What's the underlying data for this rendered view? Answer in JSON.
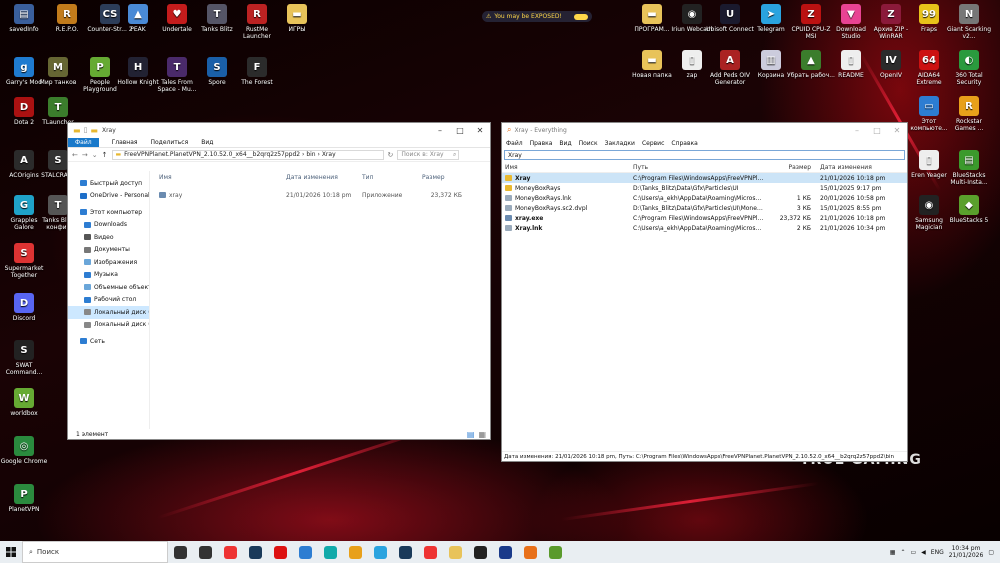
{
  "notification": {
    "text": "You may be EXPOSED!"
  },
  "desktop_icons": [
    {
      "label": "savedInfo",
      "color": "#3a5f9c",
      "glyph": "▤"
    },
    {
      "label": "R.E.P.O.",
      "color": "#c27b1b",
      "glyph": "R"
    },
    {
      "label": "Counter-Str... 2",
      "color": "#2c3d59",
      "glyph": "CS"
    },
    {
      "label": "PEAK",
      "color": "#4a8ad6",
      "glyph": "▲"
    },
    {
      "label": "Undertale",
      "color": "#c41c1c",
      "glyph": "♥"
    },
    {
      "label": "Tanks Blitz",
      "color": "#556",
      "glyph": "T"
    },
    {
      "label": "RustMe Launcher",
      "color": "#b22",
      "glyph": "R"
    },
    {
      "label": "ИГРЫ",
      "color": "#e8c35a",
      "glyph": "▬"
    },
    {
      "label": "Garry's Mod",
      "color": "#1f7bd0",
      "glyph": "g"
    },
    {
      "label": "Мир танков",
      "color": "#663",
      "glyph": "M"
    },
    {
      "label": "People Playground",
      "color": "#6a3",
      "glyph": "P"
    },
    {
      "label": "Hollow Knight",
      "color": "#223",
      "glyph": "H"
    },
    {
      "label": "Tales From Space - Mu...",
      "color": "#4a2a6a",
      "glyph": "T"
    },
    {
      "label": "Spore",
      "color": "#1a5fa8",
      "glyph": "S"
    },
    {
      "label": "The Forest",
      "color": "#2b2b2b",
      "glyph": "F"
    },
    {
      "label": "Dota 2",
      "color": "#a11",
      "glyph": "D"
    },
    {
      "label": "TLauncher",
      "color": "#3b7d2c",
      "glyph": "T"
    },
    {
      "label": "ACOrigins",
      "color": "#2b2b2b",
      "glyph": "A"
    },
    {
      "label": "STALCRAFT",
      "color": "#333",
      "glyph": "S"
    },
    {
      "label": "Grapples Galore",
      "color": "#1fa2c8",
      "glyph": "G"
    },
    {
      "label": "Tanks Blitz конфиг",
      "color": "#555",
      "glyph": "T"
    },
    {
      "label": "Supermarket Together",
      "color": "#d33",
      "glyph": "S"
    },
    {
      "label": "Discord",
      "color": "#5865f2",
      "glyph": "D"
    },
    {
      "label": "SWAT Command...",
      "color": "#222",
      "glyph": "S"
    },
    {
      "label": "worldbox",
      "color": "#6a3",
      "glyph": "W"
    },
    {
      "label": "Google Chrome",
      "color": "#2a8a3e",
      "glyph": "◎"
    },
    {
      "label": "PlanetVPN",
      "color": "#2b8a3e",
      "glyph": "P"
    },
    {
      "label": "ПРОГРАМ...",
      "color": "#e8c35a",
      "glyph": "▬"
    },
    {
      "label": "Iriun Webcam",
      "color": "#222",
      "glyph": "◉"
    },
    {
      "label": "Ubisoft Connect",
      "color": "#1a1a2e",
      "glyph": "U"
    },
    {
      "label": "Telegram",
      "color": "#2aa3df",
      "glyph": "➤"
    },
    {
      "label": "CPUID CPU-Z MSI",
      "color": "#b11",
      "glyph": "Z"
    },
    {
      "label": "Download Studio",
      "color": "#e84393",
      "glyph": "▼"
    },
    {
      "label": "Архив ZIP - WinRAR",
      "color": "#8b1a3a",
      "glyph": "Z"
    },
    {
      "label": "Fraps",
      "color": "#e8c21a",
      "glyph": "99"
    },
    {
      "label": "Giant Scarking v2...",
      "color": "#777",
      "glyph": "N"
    },
    {
      "label": "Новая папка",
      "color": "#e8c35a",
      "glyph": "▬"
    },
    {
      "label": "zap",
      "color": "#eee",
      "glyph": "▯"
    },
    {
      "label": "Add Peds OIV Generator",
      "color": "#a22",
      "glyph": "A"
    },
    {
      "label": "Корзина",
      "color": "#ccd",
      "glyph": "▥"
    },
    {
      "label": "Убрать рабоч...",
      "color": "#3b7d2c",
      "glyph": "▲"
    },
    {
      "label": "README",
      "color": "#eee",
      "glyph": "▯"
    },
    {
      "label": "OpenIV",
      "color": "#2b2b2b",
      "glyph": "IV"
    },
    {
      "label": "AIDA64 Extreme",
      "color": "#c11",
      "glyph": "64"
    },
    {
      "label": "360 Total Security",
      "color": "#2a9a3e",
      "glyph": "◐"
    },
    {
      "label": "Rockstar Games ...",
      "color": "#e8a01a",
      "glyph": "R"
    },
    {
      "label": "Eren Yeager",
      "color": "#eee",
      "glyph": "▯"
    },
    {
      "label": "BlueStacks Multi-Insta...",
      "color": "#3b9a2c",
      "glyph": "▤"
    },
    {
      "label": "Этот компьюте...",
      "color": "#2d7dd2",
      "glyph": "▭"
    },
    {
      "label": "Samsung Magician",
      "color": "#222",
      "glyph": "◉"
    },
    {
      "label": "BlueStacks 5",
      "color": "#5aa02c",
      "glyph": "◆"
    }
  ],
  "desktop_brand_text": "TRUE GAMING",
  "explorer": {
    "title": "Xray",
    "ribbon": {
      "file": "Файл",
      "home": "Главная",
      "share": "Поделиться",
      "view": "Вид"
    },
    "address": "FreeVPNPlanet.PlanetVPN_2.10.52.0_x64__b2qrq2z57ppd2  ›  bin  ›  Xray",
    "search_placeholder": "Поиск в: Xray",
    "nav": [
      {
        "label": "Быстрый доступ",
        "color": "#2d7dd2"
      },
      {
        "label": "OneDrive - Personal",
        "color": "#1e6fc9"
      },
      {
        "label": "Этот компьютер",
        "color": "#2d7dd2"
      },
      {
        "label": "Downloads",
        "color": "#2d7dd2"
      },
      {
        "label": "Видео",
        "color": "#555"
      },
      {
        "label": "Документы",
        "color": "#777"
      },
      {
        "label": "Изображения",
        "color": "#6aa6d9"
      },
      {
        "label": "Музыка",
        "color": "#2d7dd2"
      },
      {
        "label": "Объемные объекты",
        "color": "#6aa6d9"
      },
      {
        "label": "Рабочий стол",
        "color": "#2d7dd2"
      },
      {
        "label": "Локальный диск (C:)",
        "color": "#888"
      },
      {
        "label": "Локальный диск (D:)",
        "color": "#888"
      },
      {
        "label": "Сеть",
        "color": "#2d7dd2"
      }
    ],
    "columns": {
      "name": "Имя",
      "date": "Дата изменения",
      "type": "Тип",
      "size": "Размер"
    },
    "files": [
      {
        "name": "xray",
        "date": "21/01/2026 10:18 pm",
        "type": "Приложение",
        "size": "23,372 КБ"
      }
    ],
    "status": "1 элемент"
  },
  "everything": {
    "title": "Xray - Everything",
    "menu": [
      "Файл",
      "Правка",
      "Вид",
      "Поиск",
      "Закладки",
      "Сервис",
      "Справка"
    ],
    "search_value": "Xray",
    "columns": {
      "name": "Имя",
      "path": "Путь",
      "size": "Размер",
      "date": "Дата изменения"
    },
    "rows": [
      {
        "name": "Xray",
        "path": "C:\\Program Files\\WindowsApps\\FreeVPNPla...",
        "size": "",
        "date": "21/01/2026 10:18 pm",
        "kind": "folder",
        "bold": true,
        "sel": true
      },
      {
        "name": "MoneyBoxRays",
        "path": "D:\\Tanks_Blitz\\Data\\Gfx\\Particles\\UI",
        "size": "",
        "date": "15/01/2025 9:17 pm",
        "kind": "folder",
        "bold": false,
        "sel": false
      },
      {
        "name": "MoneyBoxRays.lnk",
        "path": "C:\\Users\\a_ekh\\AppData\\Roaming\\Microsoft...",
        "size": "1 КБ",
        "date": "20/01/2026 10:58 pm",
        "kind": "file",
        "bold": false,
        "sel": false
      },
      {
        "name": "MoneyBoxRays.sc2.dvpl",
        "path": "D:\\Tanks_Blitz\\Data\\Gfx\\Particles\\UI\\MoneyB...",
        "size": "3 КБ",
        "date": "15/01/2025 8:55 pm",
        "kind": "file",
        "bold": false,
        "sel": false
      },
      {
        "name": "xray.exe",
        "path": "C:\\Program Files\\WindowsApps\\FreeVPNPla...",
        "size": "23,372 КБ",
        "date": "21/01/2026 10:18 pm",
        "kind": "exe",
        "bold": true,
        "sel": false
      },
      {
        "name": "Xray.lnk",
        "path": "C:\\Users\\a_ekh\\AppData\\Roaming\\Microsoft...",
        "size": "2 КБ",
        "date": "21/01/2026 10:34 pm",
        "kind": "file",
        "bold": true,
        "sel": false
      }
    ],
    "status": "Дата изменения: 21/01/2026 10:18 pm, Путь: C:\\Program Files\\WindowsApps\\FreeVPNPlanet.PlanetVPN_2.10.52.0_x64__b2qrq2z57ppd2\\bin"
  },
  "taskbar": {
    "search_placeholder": "Поиск",
    "apps": [
      {
        "name": "cortana-icon",
        "color": "#333"
      },
      {
        "name": "task-view-icon",
        "color": "#333"
      },
      {
        "name": "yandex-icon",
        "color": "#e33"
      },
      {
        "name": "media-icon",
        "color": "#1a3a5a"
      },
      {
        "name": "opera-icon",
        "color": "#d11"
      },
      {
        "name": "app-icon",
        "color": "#2d7dd2"
      },
      {
        "name": "edge-icon",
        "color": "#1aa"
      },
      {
        "name": "chrome-icon",
        "color": "#e8a01a"
      },
      {
        "name": "telegram-icon",
        "color": "#2aa3df"
      },
      {
        "name": "steam-icon",
        "color": "#1a3a5a"
      },
      {
        "name": "yandex-browser-icon",
        "color": "#e33"
      },
      {
        "name": "explorer-icon",
        "color": "#e8c35a"
      },
      {
        "name": "terminal-icon",
        "color": "#222"
      },
      {
        "name": "monitor-icon",
        "color": "#1a3a8a"
      },
      {
        "name": "everything-icon",
        "color": "#e8701a"
      },
      {
        "name": "minecraft-icon",
        "color": "#5a9a2c"
      }
    ],
    "lang": "ENG",
    "time": "10:34 pm",
    "date": "21/01/2026"
  }
}
